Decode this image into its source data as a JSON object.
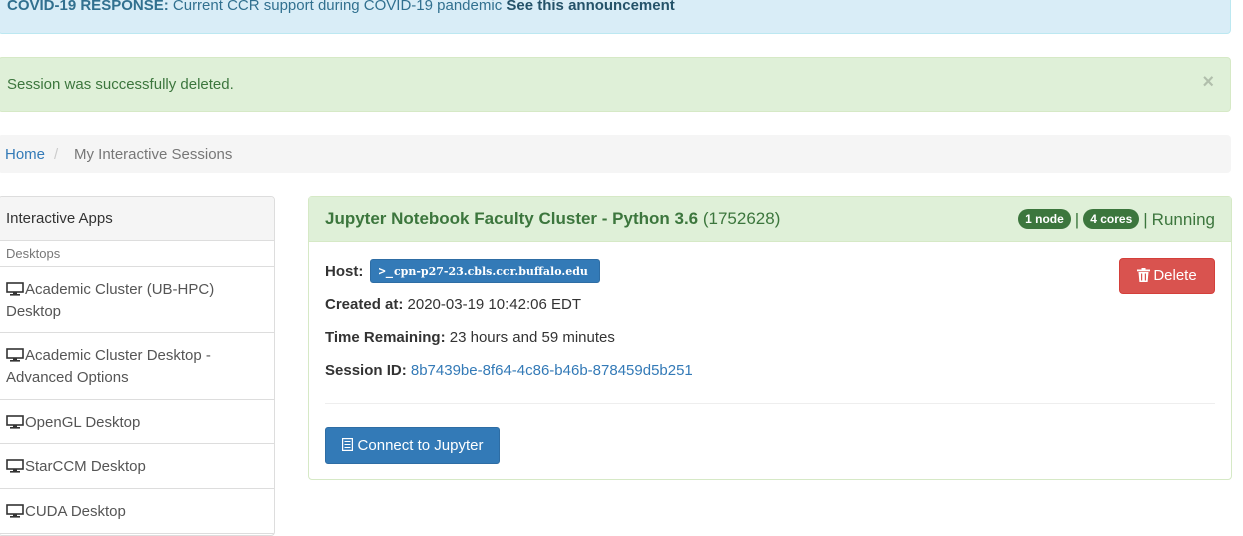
{
  "banner": {
    "label": "COVID-19 RESPONSE:",
    "text": "Current CCR support during COVID-19 pandemic",
    "link": "See this announcement"
  },
  "alert": {
    "message": "Session was successfully deleted.",
    "close": "×"
  },
  "breadcrumb": {
    "home": "Home",
    "separator": "/",
    "current": "My Interactive Sessions"
  },
  "sidebar": {
    "heading": "Interactive Apps",
    "section": "Desktops",
    "items": [
      {
        "label": "Academic Cluster (UB-HPC) Desktop",
        "icon": "desktop-icon"
      },
      {
        "label": "Academic Cluster Desktop - Advanced Options",
        "icon": "desktop-icon"
      },
      {
        "label": "OpenGL Desktop",
        "icon": "desktop-icon"
      },
      {
        "label": "StarCCM Desktop",
        "icon": "desktop-icon"
      },
      {
        "label": "CUDA Desktop",
        "icon": "desktop-icon"
      }
    ]
  },
  "session": {
    "title": "Jupyter Notebook Faculty Cluster - Python 3.6",
    "job_id": "(1752628)",
    "nodes": "1 node",
    "cores": "4 cores",
    "separator": "|",
    "status": "Running",
    "host_label": "Host:",
    "host_prompt": ">_",
    "host": "cpn-p27-23.cbls.ccr.buffalo.edu",
    "created_label": "Created at:",
    "created": "2020-03-19 10:42:06 EDT",
    "remaining_label": "Time Remaining:",
    "remaining": "23 hours and 59 minutes",
    "session_id_label": "Session ID:",
    "session_id": "8b7439be-8f64-4c86-b46b-878459d5b251",
    "delete_label": "Delete",
    "connect_label": "Connect to Jupyter"
  },
  "colors": {
    "info_bg": "#d9edf7",
    "success_bg": "#dff0d8",
    "success_text": "#3c763d",
    "primary": "#337ab7",
    "danger": "#d9534f"
  }
}
